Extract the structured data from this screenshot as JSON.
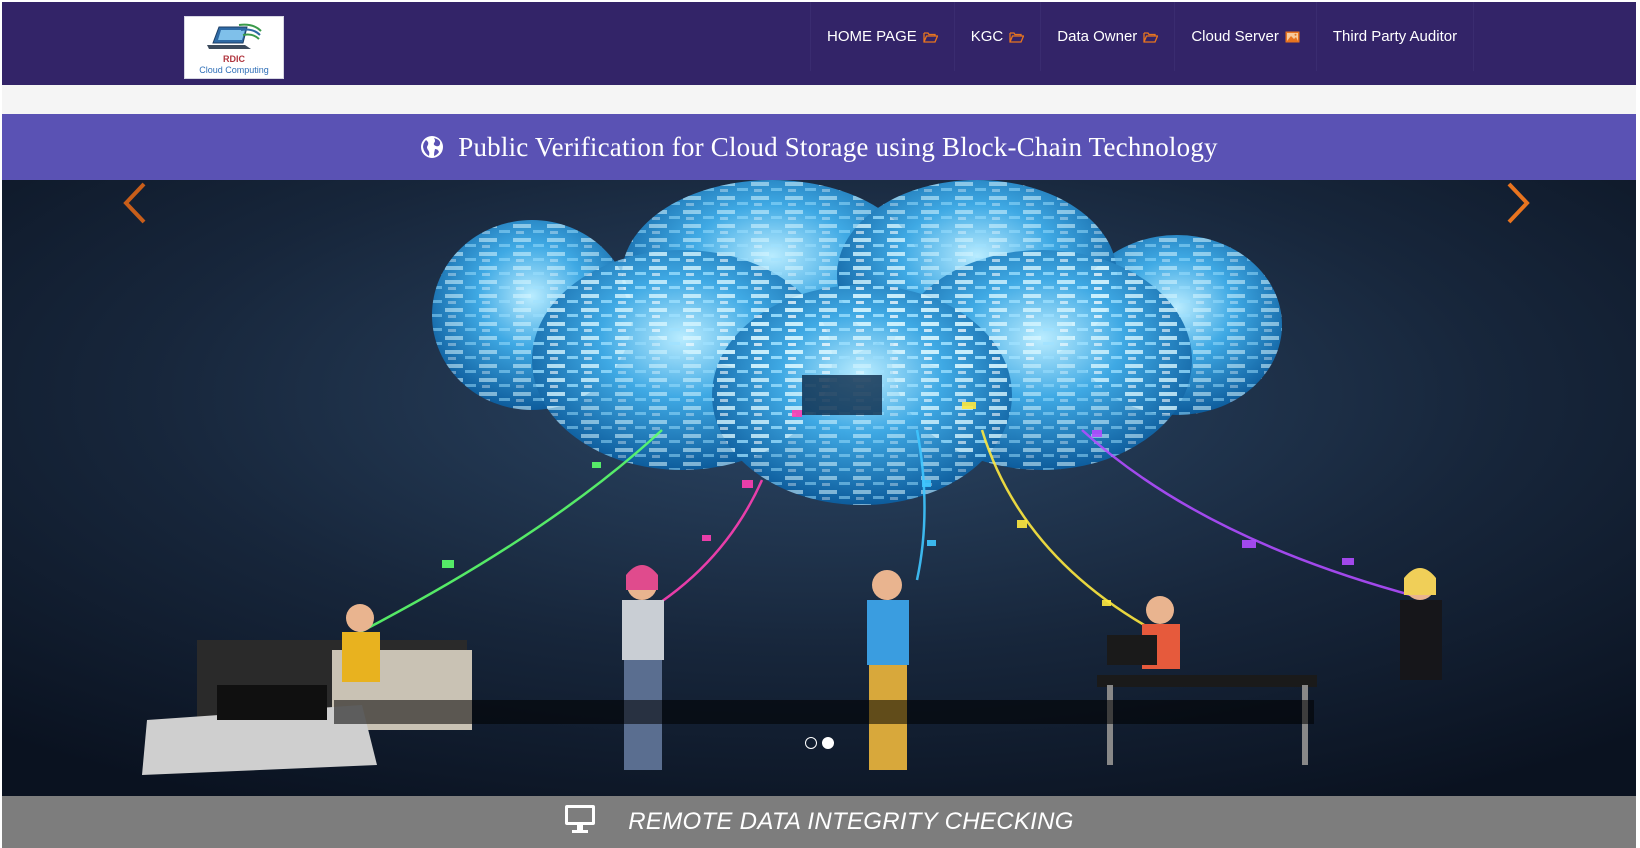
{
  "header": {
    "logo": {
      "line1": "RDIC",
      "line2": "Cloud Computing"
    },
    "nav": [
      {
        "label": "HOME PAGE",
        "icon": "folder-open-icon"
      },
      {
        "label": "KGC",
        "icon": "folder-open-icon"
      },
      {
        "label": "Data Owner",
        "icon": "folder-open-icon"
      },
      {
        "label": "Cloud Server",
        "icon": "image-icon"
      },
      {
        "label": "Third Party Auditor",
        "icon": ""
      }
    ]
  },
  "title_bar": {
    "text": "Public Verification for Cloud Storage using Block-Chain Technology",
    "icon": "globe-icon"
  },
  "carousel": {
    "prev_icon": "chevron-left-icon",
    "next_icon": "chevron-right-icon",
    "slide_count": 2,
    "active_slide": 2
  },
  "footer_bar": {
    "text": "REMOTE DATA INTEGRITY CHECKING",
    "icon": "monitor-icon"
  },
  "colors": {
    "navbar": "#332468",
    "title_bar": "#5a52b4",
    "footer_bar": "#7d7d7d",
    "accent_orange": "#e8741f"
  }
}
